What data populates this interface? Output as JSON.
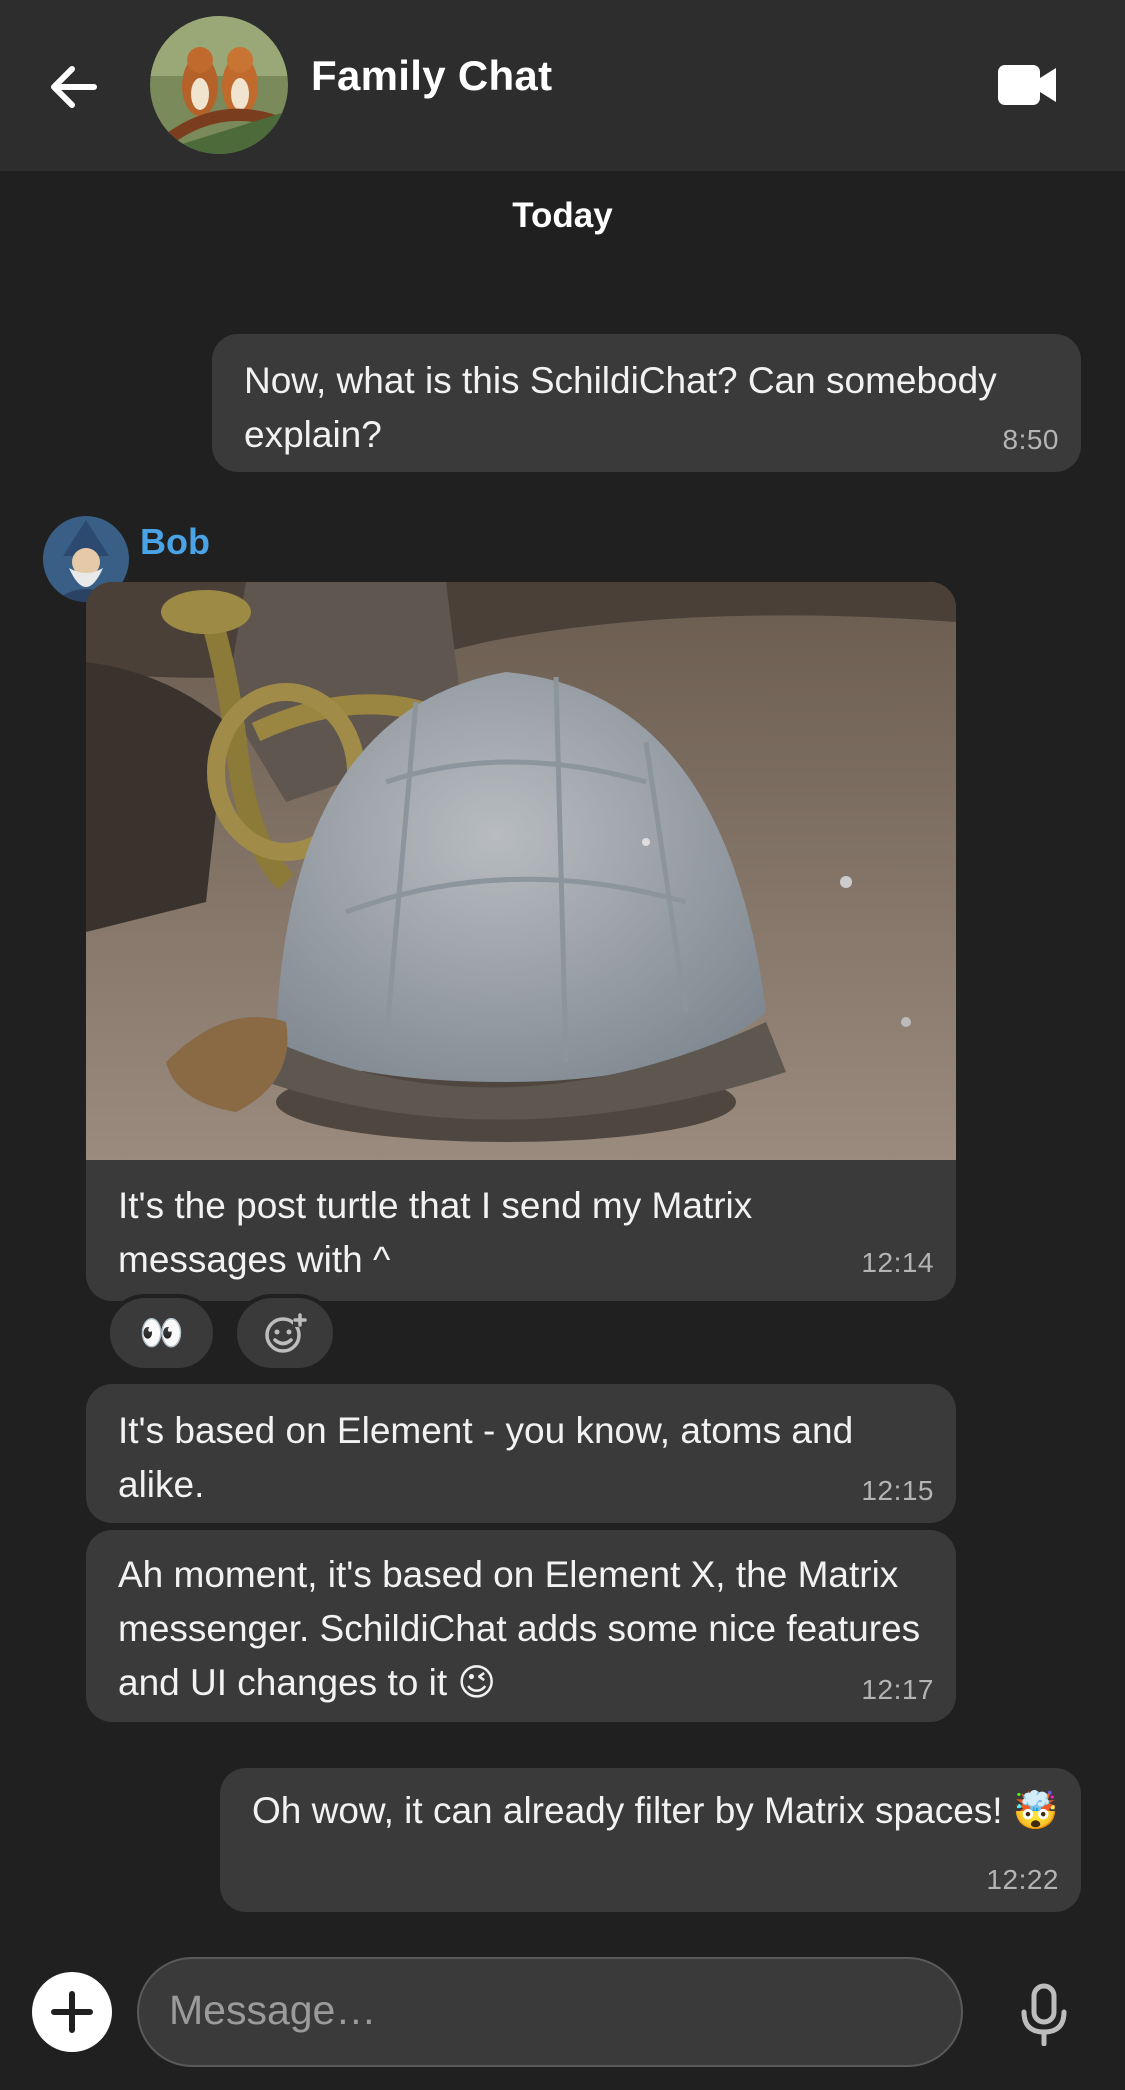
{
  "header": {
    "title": "Family Chat",
    "back_icon": "arrow-left-icon",
    "call_icon": "video-camera-icon"
  },
  "timeline": {
    "date_separator": "Today",
    "messages": [
      {
        "own": true,
        "text": "Now, what is this SchildiChat? Can somebody explain?",
        "time": "8:50"
      },
      {
        "sender": "Bob",
        "type": "image",
        "caption": "It's the post turtle that I send my Matrix messages with ^",
        "time": "12:14",
        "reactions": [
          {
            "emoji": "👀"
          }
        ],
        "add_reaction_icon": "add-reaction-icon"
      },
      {
        "sender": "Bob",
        "text": "It's based on Element - you know, atoms and alike.",
        "time": "12:15"
      },
      {
        "sender": "Bob",
        "text": "Ah moment, it's based on Element X, the Matrix messenger. SchildiChat adds some nice features and UI changes to it 😉",
        "time": "12:17"
      },
      {
        "own": true,
        "text": "Oh wow, it can already filter by Matrix spaces! 🤯",
        "time": "12:22"
      }
    ]
  },
  "composer": {
    "placeholder": "Message…",
    "add_icon": "plus-icon",
    "mic_icon": "microphone-icon"
  },
  "colors": {
    "background": "#202020",
    "topbar": "#2d2d2d",
    "bubble": "#3a3a3a",
    "sender_name": "#4aa3e6"
  }
}
